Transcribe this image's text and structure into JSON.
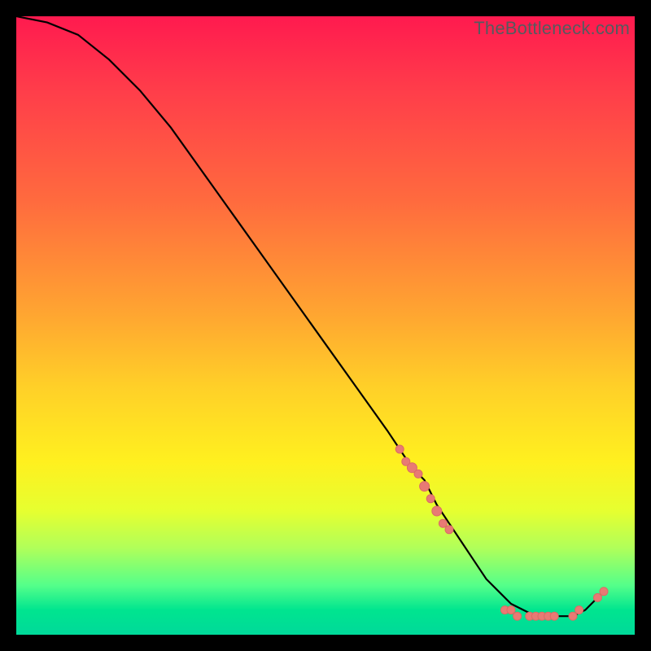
{
  "watermark": "TheBottleneck.com",
  "chart_data": {
    "type": "line",
    "title": "",
    "xlabel": "",
    "ylabel": "",
    "xlim": [
      0,
      100
    ],
    "ylim": [
      0,
      100
    ],
    "grid": false,
    "legend": false,
    "background_gradient": [
      {
        "stop": 0,
        "color": "#ff1a4f"
      },
      {
        "stop": 50,
        "color": "#ffd028"
      },
      {
        "stop": 80,
        "color": "#fff01f"
      },
      {
        "stop": 100,
        "color": "#00d99a"
      }
    ],
    "series": [
      {
        "name": "curve",
        "x": [
          0,
          5,
          10,
          15,
          20,
          25,
          30,
          35,
          40,
          45,
          50,
          55,
          60,
          62,
          64,
          65,
          66,
          67,
          68,
          70,
          72,
          74,
          76,
          78,
          80,
          82,
          84,
          86,
          88,
          90,
          92,
          94,
          95
        ],
        "y": [
          100,
          99,
          97,
          93,
          88,
          82,
          75,
          68,
          61,
          54,
          47,
          40,
          33,
          30,
          27,
          26,
          25,
          23,
          21,
          18,
          15,
          12,
          9,
          7,
          5,
          4,
          3,
          3,
          3,
          3,
          4,
          6,
          7
        ]
      }
    ],
    "markers": [
      {
        "x": 62,
        "y": 30,
        "r": 5
      },
      {
        "x": 63,
        "y": 28,
        "r": 5
      },
      {
        "x": 64,
        "y": 27,
        "r": 6
      },
      {
        "x": 65,
        "y": 26,
        "r": 5
      },
      {
        "x": 66,
        "y": 24,
        "r": 6
      },
      {
        "x": 67,
        "y": 22,
        "r": 5
      },
      {
        "x": 68,
        "y": 20,
        "r": 6
      },
      {
        "x": 69,
        "y": 18,
        "r": 5
      },
      {
        "x": 70,
        "y": 17,
        "r": 5
      },
      {
        "x": 79,
        "y": 4,
        "r": 5
      },
      {
        "x": 80,
        "y": 4,
        "r": 5
      },
      {
        "x": 81,
        "y": 3,
        "r": 5
      },
      {
        "x": 83,
        "y": 3,
        "r": 5
      },
      {
        "x": 84,
        "y": 3,
        "r": 5
      },
      {
        "x": 85,
        "y": 3,
        "r": 5
      },
      {
        "x": 86,
        "y": 3,
        "r": 5
      },
      {
        "x": 87,
        "y": 3,
        "r": 5
      },
      {
        "x": 90,
        "y": 3,
        "r": 5
      },
      {
        "x": 91,
        "y": 4,
        "r": 5
      },
      {
        "x": 94,
        "y": 6,
        "r": 5
      },
      {
        "x": 95,
        "y": 7,
        "r": 5
      }
    ],
    "marker_color": "#e87a74"
  }
}
